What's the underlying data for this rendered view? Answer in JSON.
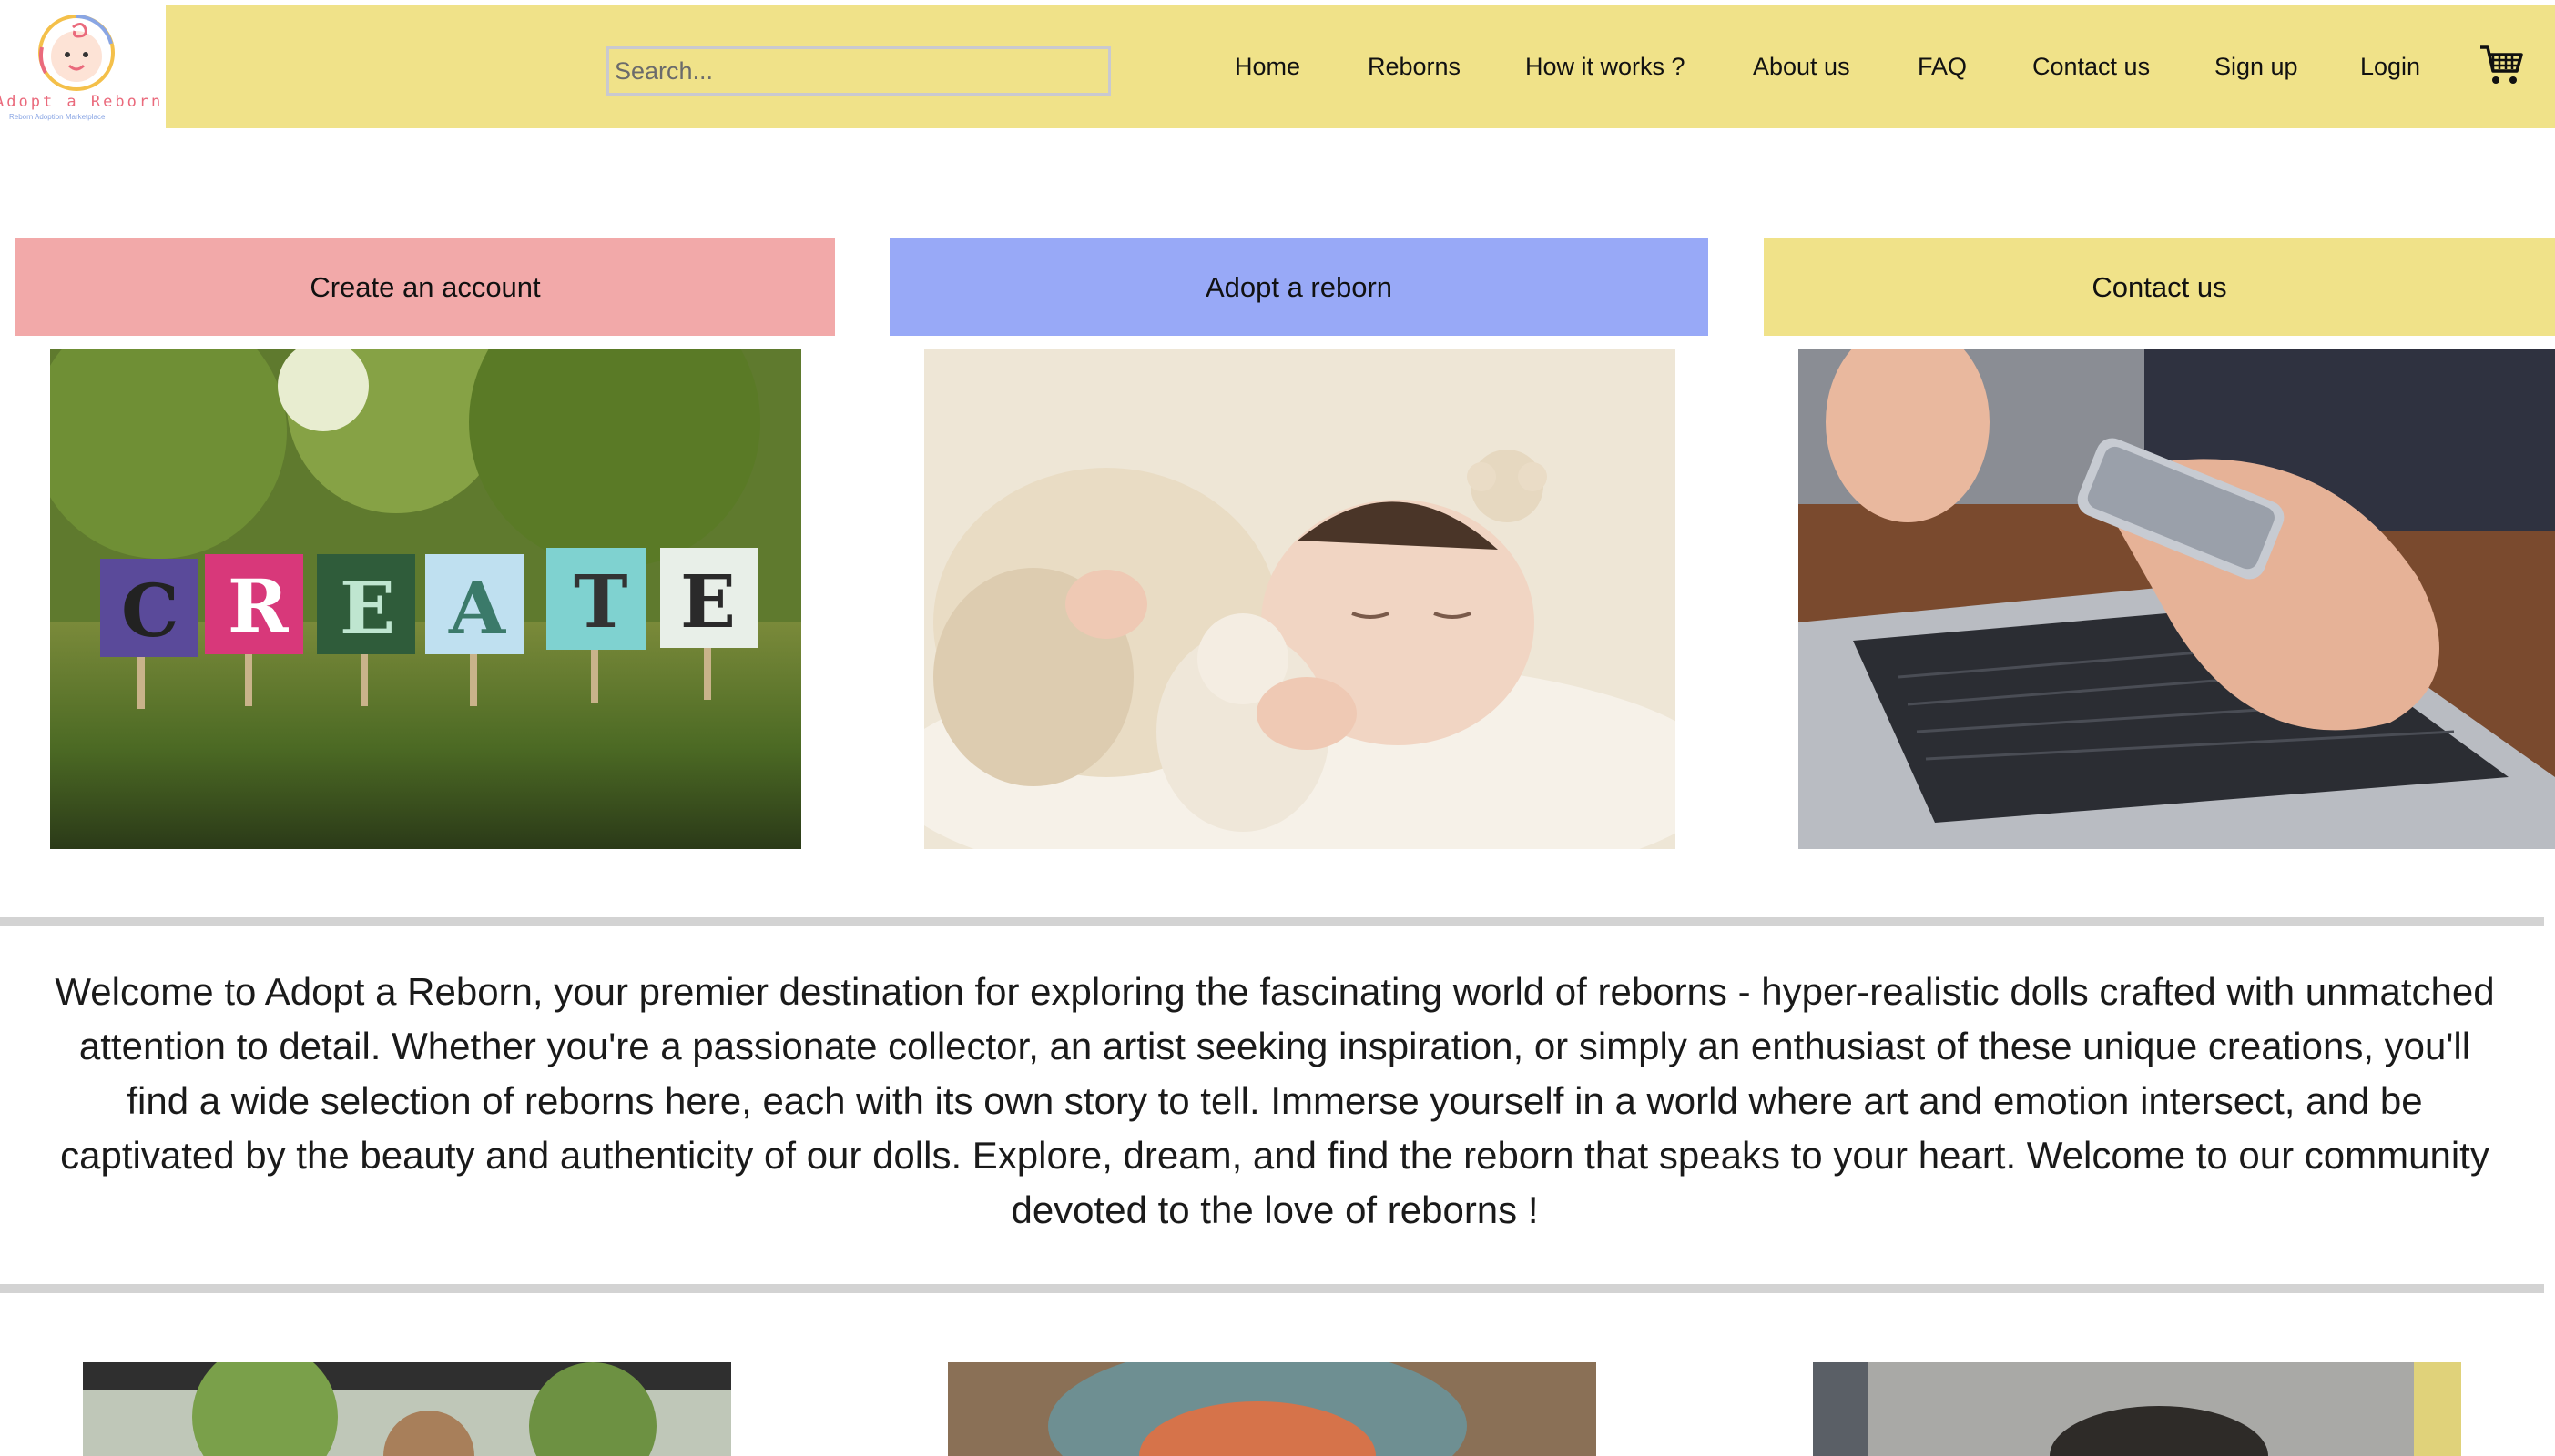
{
  "logo": {
    "title": "Adopt a Reborn",
    "subtitle": "Reborn Adoption Marketplace"
  },
  "search": {
    "placeholder": "Search..."
  },
  "nav": {
    "home": "Home",
    "reborns": "Reborns",
    "how": "How it works ?",
    "about": "About us",
    "faq": "FAQ",
    "contact": "Contact us",
    "signup": "Sign up",
    "login": "Login",
    "cart_icon": "shopping-cart-icon"
  },
  "cards": [
    {
      "label": "Create an account",
      "color": "#f2a9a9",
      "image": "create-letters-on-lawn"
    },
    {
      "label": "Adopt a reborn",
      "color": "#98a9f7",
      "image": "sleeping-baby-doll"
    },
    {
      "label": "Contact us",
      "color": "#f0e289",
      "image": "phone-and-laptop"
    }
  ],
  "welcome_text": "Welcome to Adopt a Reborn, your premier destination for exploring the fascinating world of reborns - hyper-realistic dolls crafted with unmatched attention to detail. Whether you're a passionate collector, an artist seeking inspiration, or simply an enthusiast of these unique creations, you'll find a wide selection of reborns here, each with its own story to tell. Immerse yourself in a world where art and emotion intersect, and be captivated by the beauty and authenticity of our dolls. Explore, dream, and find the reborn that speaks to your heart. Welcome to our community devoted to the love of reborns !",
  "colors": {
    "nav_bg": "#f0e289",
    "create_bg": "#f2a9a9",
    "adopt_bg": "#98a9f7",
    "contact_bg": "#f0e289",
    "divider": "#d3d3d3"
  }
}
